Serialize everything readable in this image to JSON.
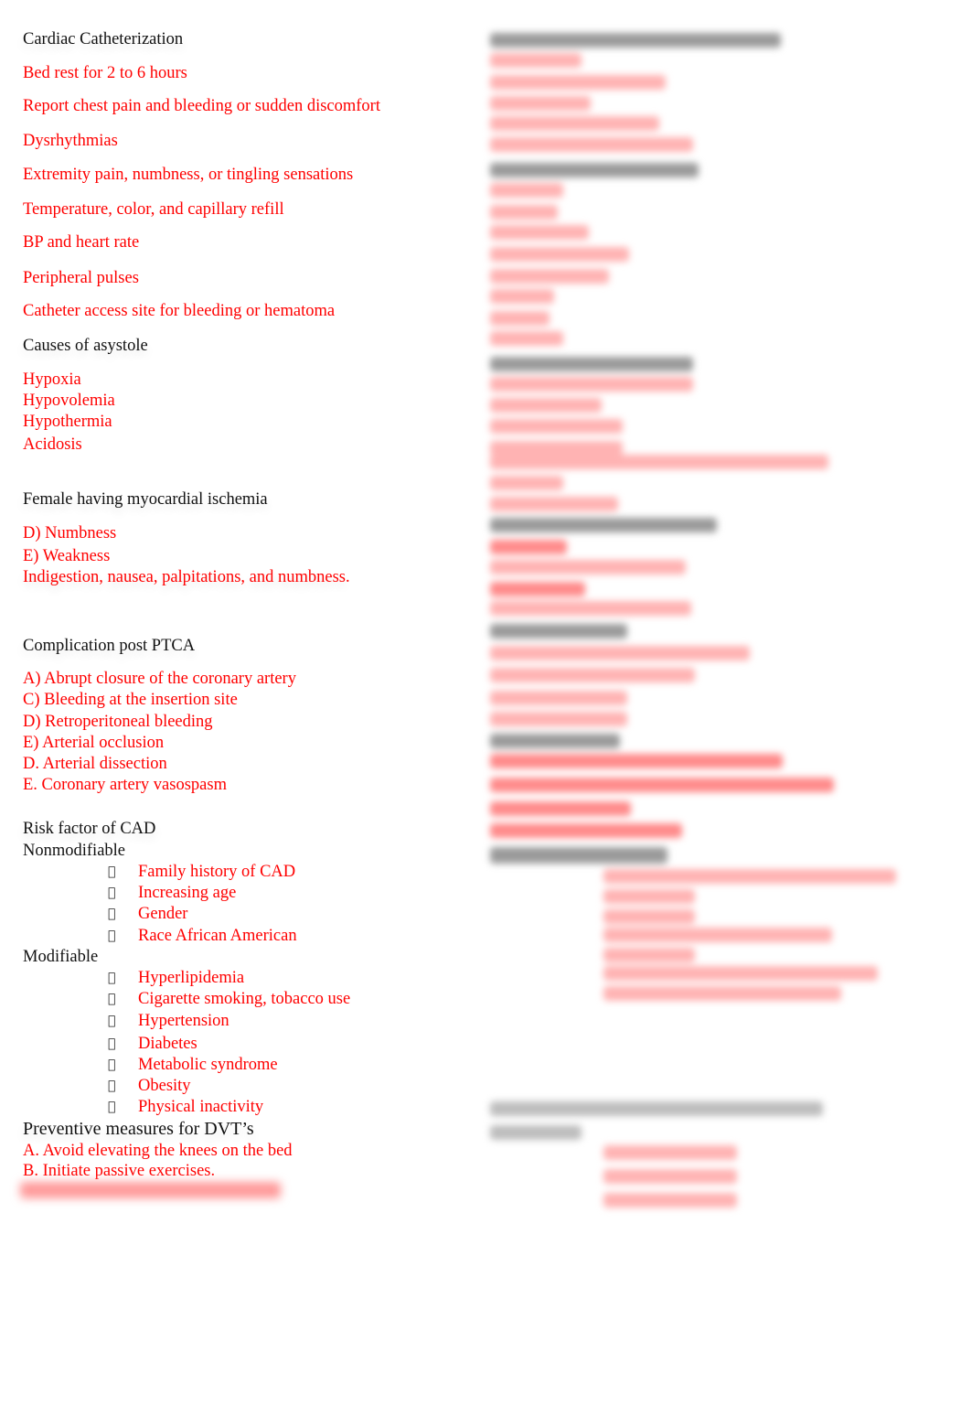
{
  "left_column": {
    "cardiac_cath": {
      "heading": "Cardiac Catheterization",
      "items": [
        "Bed rest for 2 to 6 hours",
        "Report chest pain and bleeding or sudden discomfort",
        "Dysrhythmias",
        "Extremity pain, numbness, or tingling sensations",
        "Temperature, color, and capillary refill",
        "BP and heart rate",
        "Peripheral pulses",
        "Catheter access site for bleeding or hematoma"
      ]
    },
    "asystole": {
      "heading": "Causes of asystole",
      "items": [
        "Hypoxia",
        "Hypovolemia",
        "Hypothermia",
        "Acidosis"
      ]
    },
    "female_ischemia": {
      "heading": "Female having myocardial ischemia",
      "items": [
        "D) Numbness",
        "E) Weakness",
        "Indigestion, nausea, palpitations, and numbness."
      ]
    },
    "ptca": {
      "heading": "Complication post PTCA",
      "items": [
        "A) Abrupt closure of the coronary artery",
        "C) Bleeding at the insertion site",
        "D) Retroperitoneal bleeding",
        "E) Arterial occlusion",
        "D. Arterial dissection",
        "E. Coronary artery vasospasm"
      ]
    },
    "cad": {
      "heading": "Risk factor of CAD",
      "nonmodifiable_label": "Nonmodifiable",
      "nonmodifiable": [
        "Family history of CAD",
        "Increasing age",
        "Gender",
        "Race African American"
      ],
      "modifiable_label": "Modifiable",
      "modifiable": [
        "Hyperlipidemia",
        "Cigarette smoking, tobacco use",
        "Hypertension",
        "Diabetes",
        "Metabolic syndrome",
        "Obesity",
        "Physical inactivity"
      ],
      "bullet_glyph": ""
    },
    "dvt": {
      "heading": "Preventive measures for DVT’s",
      "items": [
        "A. Avoid elevating the knees on the bed",
        "B. Initiate passive exercises."
      ]
    }
  },
  "right_column": {
    "state": "blurred / obscured content"
  },
  "colors": {
    "heading": "#111111",
    "answer": "#ff0000",
    "background": "#ffffff"
  }
}
